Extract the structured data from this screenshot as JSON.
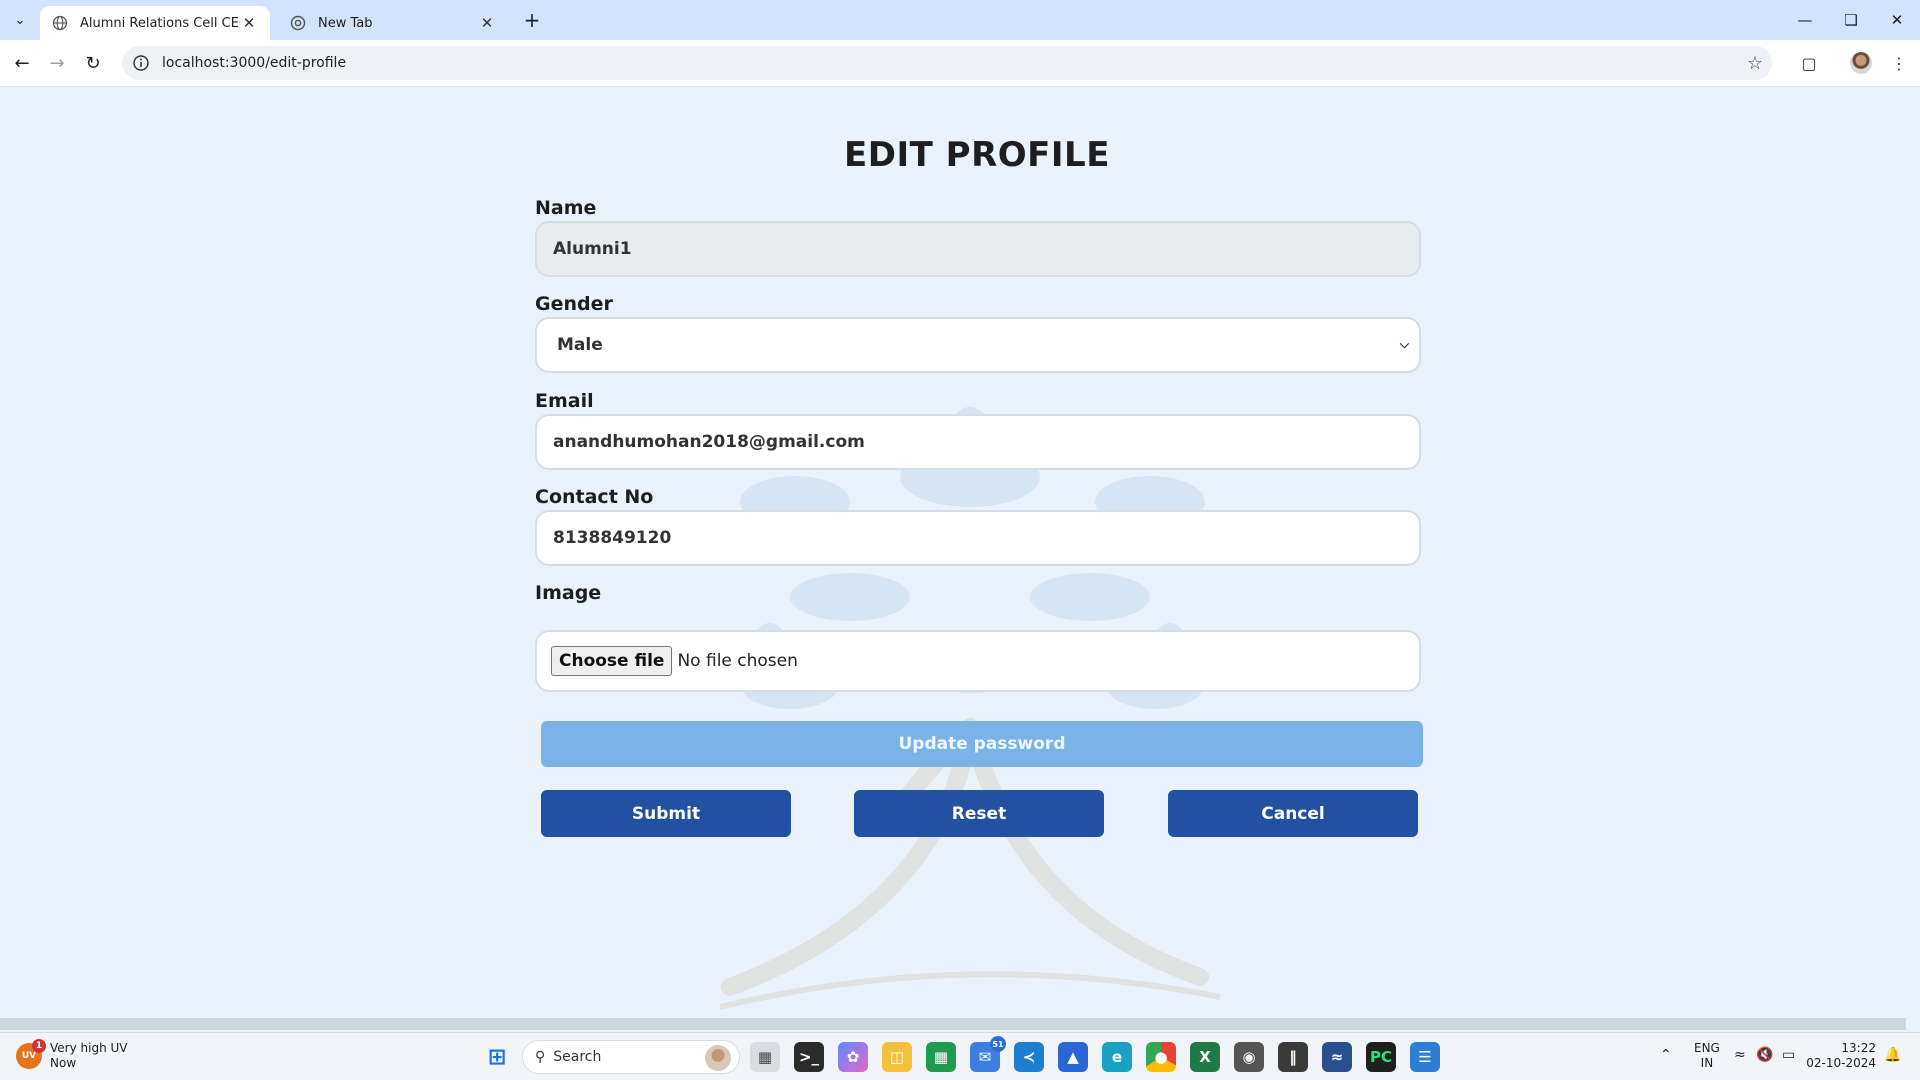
{
  "browser": {
    "tabs": [
      {
        "title": "Alumni Relations Cell CEC",
        "active": true
      },
      {
        "title": "New Tab",
        "active": false
      }
    ],
    "url": "localhost:3000/edit-profile"
  },
  "page": {
    "title": "EDIT PROFILE",
    "name": {
      "label": "Name",
      "value": "Alumni1"
    },
    "gender": {
      "label": "Gender",
      "value": "Male"
    },
    "email": {
      "label": "Email",
      "value": "anandhumohan2018@gmail.com"
    },
    "contact": {
      "label": "Contact No",
      "value": "8138849120"
    },
    "image": {
      "label": "Image",
      "button": "Choose file",
      "status": "No file chosen"
    },
    "update_password": "Update password",
    "submit": "Submit",
    "reset": "Reset",
    "cancel": "Cancel"
  },
  "colors": {
    "page_bg": "#eaf3fc",
    "primary_button": "#2351a2",
    "update_password_button": "#7ab4e6",
    "disabled_input": "#e9ecef"
  },
  "taskbar": {
    "weather_title": "Very high UV",
    "weather_sub": "Now",
    "weather_icon_text": "UV",
    "weather_badge": "1",
    "search_placeholder": "Search",
    "mail_badge": "51",
    "lang_line1": "ENG",
    "lang_line2": "IN",
    "time": "13:22",
    "date": "02-10-2024"
  }
}
